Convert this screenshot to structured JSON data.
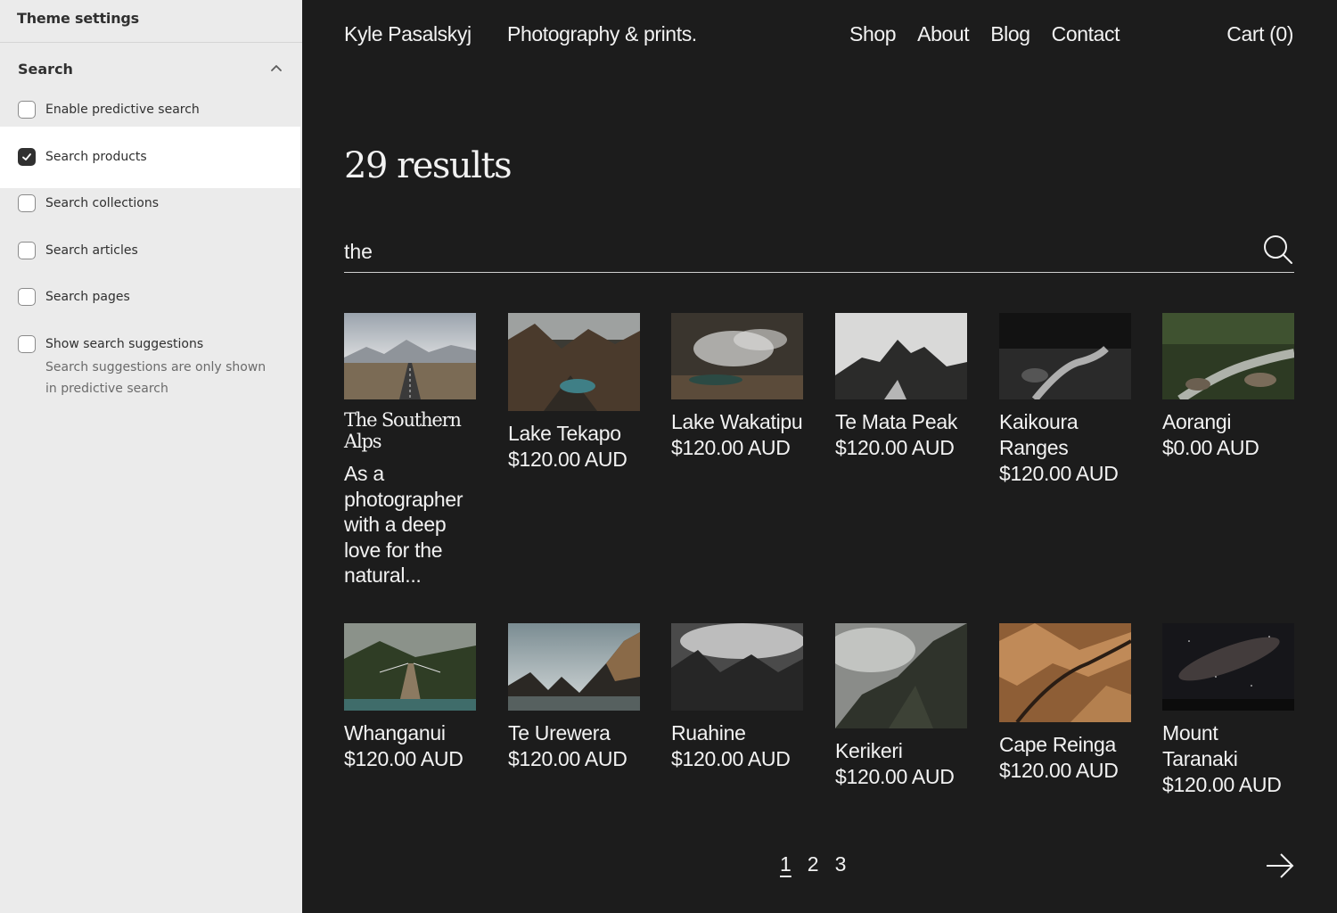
{
  "sidebar": {
    "title": "Theme settings",
    "section_title": "Search",
    "options": [
      {
        "label": "Enable predictive search",
        "checked": false
      },
      {
        "label": "Search products",
        "checked": true
      },
      {
        "label": "Search collections",
        "checked": false
      },
      {
        "label": "Search articles",
        "checked": false
      },
      {
        "label": "Search pages",
        "checked": false
      },
      {
        "label": "Show search suggestions",
        "checked": false,
        "help": "Search suggestions are only shown in predictive search"
      }
    ]
  },
  "header": {
    "brand": "Kyle Pasalskyj",
    "tagline": "Photography & prints.",
    "nav": [
      "Shop",
      "About",
      "Blog",
      "Contact"
    ],
    "cart": "Cart (0)"
  },
  "results": {
    "title": "29 results",
    "query": "the"
  },
  "items": [
    {
      "name": "The Southern Alps",
      "excerpt": "As a photographer with a deep love for the natural...",
      "type": "article"
    },
    {
      "name": "Lake Tekapo",
      "price": "$120.00 AUD"
    },
    {
      "name": "Lake Wakatipu",
      "price": "$120.00 AUD"
    },
    {
      "name": "Te Mata Peak",
      "price": "$120.00 AUD"
    },
    {
      "name": "Kaikoura Ranges",
      "price": "$120.00 AUD"
    },
    {
      "name": "Aorangi",
      "price": "$0.00 AUD"
    },
    {
      "name": "Whanganui",
      "price": "$120.00 AUD"
    },
    {
      "name": "Te Urewera",
      "price": "$120.00 AUD"
    },
    {
      "name": "Ruahine",
      "price": "$120.00 AUD"
    },
    {
      "name": "Kerikeri",
      "price": "$120.00 AUD"
    },
    {
      "name": "Cape Reinga",
      "price": "$120.00 AUD"
    },
    {
      "name": "Mount Taranaki",
      "price": "$120.00 AUD"
    }
  ],
  "pagination": {
    "pages": [
      "1",
      "2",
      "3"
    ],
    "current": "1",
    "next_icon": "arrow-right-icon"
  },
  "colors": {
    "main_bg": "#1c1c1c",
    "sidebar_bg": "#ebebeb",
    "text_light": "#f2f2f2"
  }
}
